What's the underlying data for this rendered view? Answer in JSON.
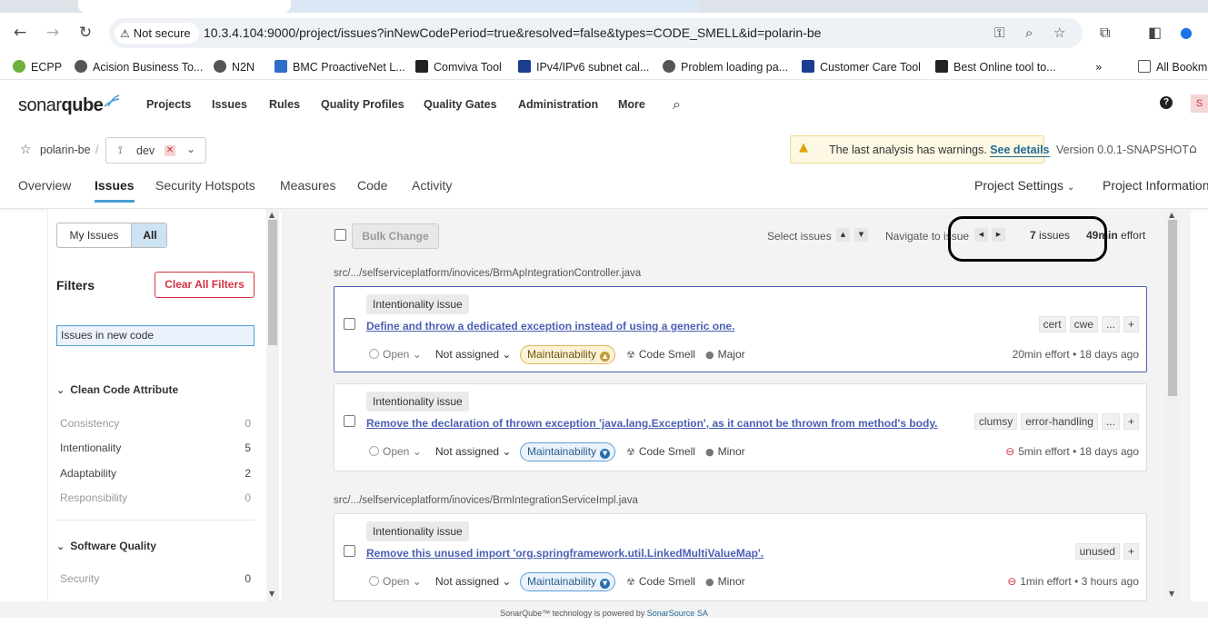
{
  "browser": {
    "security_label": "Not secure",
    "url": "10.3.4.104:9000/project/issues?inNewCodePeriod=true&resolved=false&types=CODE_SMELL&id=polarin-be",
    "bookmarks": [
      {
        "label": "ECPP",
        "color": "#6cb23a"
      },
      {
        "label": "Acision Business To...",
        "color": "#555555"
      },
      {
        "label": "N2N",
        "color": "#555555"
      },
      {
        "label": "BMC ProactiveNet L...",
        "color": "#2e6ec9"
      },
      {
        "label": "Comviva Tool",
        "color": "#222222"
      },
      {
        "label": "IPv4/IPv6 subnet cal...",
        "color": "#1a3d8f"
      },
      {
        "label": "Problem loading pa...",
        "color": "#555555"
      },
      {
        "label": "Customer Care Tool",
        "color": "#1a3d8f"
      },
      {
        "label": "Best Online tool to...",
        "color": "#222222"
      }
    ],
    "all_bookmarks": "All Bookm"
  },
  "header": {
    "logo_light": "sonar",
    "logo_bold": "qube",
    "nav": [
      "Projects",
      "Issues",
      "Rules",
      "Quality Profiles",
      "Quality Gates",
      "Administration",
      "More"
    ],
    "avatar_letter": "S"
  },
  "project": {
    "name": "polarin-be",
    "branch": "dev",
    "warning_text": "The last analysis has warnings.",
    "warning_link": "See details",
    "version": "Version 0.0.1-SNAPSHOT",
    "tabs": [
      "Overview",
      "Issues",
      "Security Hotspots",
      "Measures",
      "Code",
      "Activity"
    ],
    "active_tab": "Issues",
    "settings_label": "Project Settings",
    "info_label": "Project Information"
  },
  "sidebar": {
    "my_issues": "My Issues",
    "all": "All",
    "filters_title": "Filters",
    "clear_filters": "Clear All Filters",
    "new_code_chip": "Issues in new code",
    "clean_code_title": "Clean Code Attribute",
    "clean_code_items": [
      {
        "label": "Consistency",
        "count": "0"
      },
      {
        "label": "Intentionality",
        "count": "5"
      },
      {
        "label": "Adaptability",
        "count": "2"
      },
      {
        "label": "Responsibility",
        "count": "0"
      }
    ],
    "software_quality_title": "Software Quality",
    "software_quality_items": [
      {
        "label": "Security",
        "count": "0"
      }
    ]
  },
  "toolbar": {
    "bulk_change": "Bulk Change",
    "select_issues": "Select issues",
    "navigate_to_issue": "Navigate to issue",
    "issues_count": "7",
    "issues_label": "issues",
    "effort_value": "49min",
    "effort_label": "effort"
  },
  "groups": [
    {
      "path": "src/.../selfserviceplatform/inovices/BrmApIntegrationController.java",
      "issues": [
        {
          "pill": "Intentionality issue",
          "title": "Define and throw a dedicated exception instead of using a generic one.",
          "tags": [
            "cert",
            "cwe",
            "...",
            "+"
          ],
          "status": "Open",
          "assignee": "Not assigned",
          "quality": "Maintainability",
          "type": "Code Smell",
          "severity": "Major",
          "effort": "20min effort",
          "age": "18 days ago"
        },
        {
          "pill": "Intentionality issue",
          "title": "Remove the declaration of thrown exception 'java.lang.Exception', as it cannot be thrown from method's body.",
          "tags": [
            "clumsy",
            "error-handling",
            "...",
            "+"
          ],
          "status": "Open",
          "assignee": "Not assigned",
          "quality": "Maintainability",
          "type": "Code Smell",
          "severity": "Minor",
          "effort": "5min effort",
          "age": "18 days ago"
        }
      ]
    },
    {
      "path": "src/.../selfserviceplatform/inovices/BrmIntegrationServiceImpl.java",
      "issues": [
        {
          "pill": "Intentionality issue",
          "title": "Remove this unused import 'org.springframework.util.LinkedMultiValueMap'.",
          "tags": [
            "unused",
            "+"
          ],
          "status": "Open",
          "assignee": "Not assigned",
          "quality": "Maintainability",
          "type": "Code Smell",
          "severity": "Minor",
          "effort": "1min effort",
          "age": "3 hours ago"
        }
      ]
    }
  ],
  "footer": {
    "text": "SonarQube™ technology is powered by",
    "link": "SonarSource SA"
  },
  "colors": {
    "accent": "#4b9fd5",
    "link": "#4b5fb3",
    "danger": "#d4333f",
    "major": "#e1b65a",
    "minor": "#5a9ed8"
  }
}
